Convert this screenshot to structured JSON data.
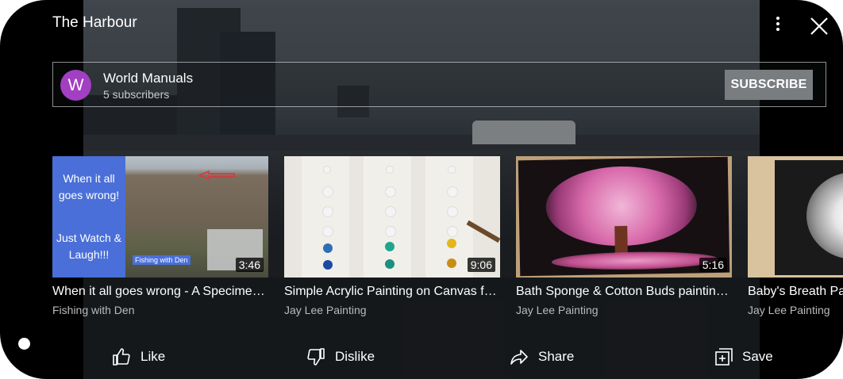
{
  "header": {
    "title": "The Harbour"
  },
  "channel": {
    "avatar_letter": "W",
    "avatar_color": "#a23fc2",
    "name": "World Manuals",
    "subscribers": "5 subscribers",
    "subscribe_label": "SUBSCRIBE"
  },
  "videos": [
    {
      "title": "When it all goes wrong - A Specimen Carp",
      "channel": "Fishing with Den",
      "duration": "3:46",
      "overlay_line1": "When it all goes wrong!",
      "overlay_line2": "Just Watch & Laugh!!!",
      "overlay_tag": "Fishing with Den"
    },
    {
      "title": "Simple Acrylic Painting on Canvas for Beginners",
      "channel": "Jay Lee Painting",
      "duration": "9:06"
    },
    {
      "title": "Bath Sponge & Cotton Buds painting Cherry Blossom",
      "channel": "Jay Lee Painting",
      "duration": "5:16"
    },
    {
      "title": "Baby's Breath Painting",
      "channel": "Jay Lee Painting",
      "duration": ""
    }
  ],
  "actions": {
    "like": "Like",
    "dislike": "Dislike",
    "share": "Share",
    "save": "Save"
  },
  "icons": [
    "more-vert-icon",
    "close-icon",
    "thumb-up-icon",
    "thumb-down-icon",
    "share-icon",
    "add-to-playlist-icon"
  ]
}
